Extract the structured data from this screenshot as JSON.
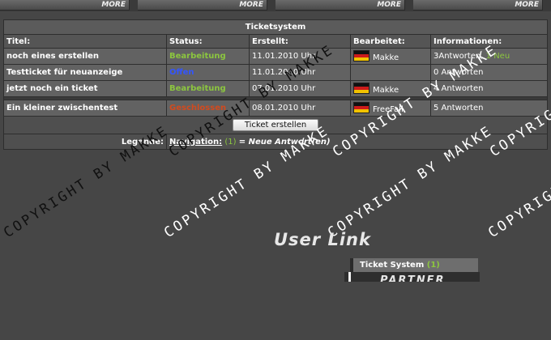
{
  "top_nav": {
    "more_buttons": [
      "MORE",
      "MORE",
      "MORE",
      "MORE"
    ]
  },
  "ticketsystem": {
    "title": "Ticketsystem",
    "columns": [
      "Titel:",
      "Status:",
      "Erstellt:",
      "Bearbeitet:",
      "Informationen:"
    ],
    "rows": [
      {
        "title": "noch eines erstellen",
        "status": "Bearbeitung",
        "status_color": "#8cc63f",
        "created": "11.01.2010 Uhr",
        "editor": "Makke",
        "info": "3Antworten,",
        "info_new": "1 Neu"
      },
      {
        "title": "Testticket für neuanzeige",
        "status": "Offen",
        "status_color": "#3355ff",
        "created": "11.01.2010 Uhr",
        "editor": "",
        "info": "0 Antworten",
        "info_new": ""
      },
      {
        "title": "jetzt noch ein ticket",
        "status": "Bearbeitung",
        "status_color": "#8cc63f",
        "created": "07.01.2010 Uhr",
        "editor": "Makke",
        "info": "4 Antworten",
        "info_new": ""
      }
    ],
    "closed_rows": [
      {
        "title": "Ein kleiner zwischentest",
        "status": "Geschlossen",
        "status_color": "#d24a1e",
        "created": "08.01.2010 Uhr",
        "editor": "FreeFall",
        "info": "5 Antworten",
        "info_new": ""
      }
    ],
    "create_button": "Ticket erstellen",
    "legend_label": "Legende:",
    "legend_nav": "Navigation:",
    "legend_count": "(1)",
    "legend_text": "= Neue Antwort(en)"
  },
  "watermarks": [
    "COPYRIGHT BY MAKKE",
    "COPYRIGHT BY MAKKE",
    "COPYRIGHT BY MAKKE",
    "COPYRIGHT BY MAKKE",
    "COPYRIGHT BY MAKKE",
    "COPYRIGHT BY MAKKE",
    "COPYRIGHT"
  ],
  "user_link": {
    "heading": "User Link",
    "item_label": "Ticket System",
    "item_count": "(1)",
    "partner_label": "PARTNER"
  },
  "colors": {
    "background": "#464646",
    "status_green": "#8cc63f",
    "status_blue": "#3355ff",
    "status_red": "#d24a1e"
  }
}
